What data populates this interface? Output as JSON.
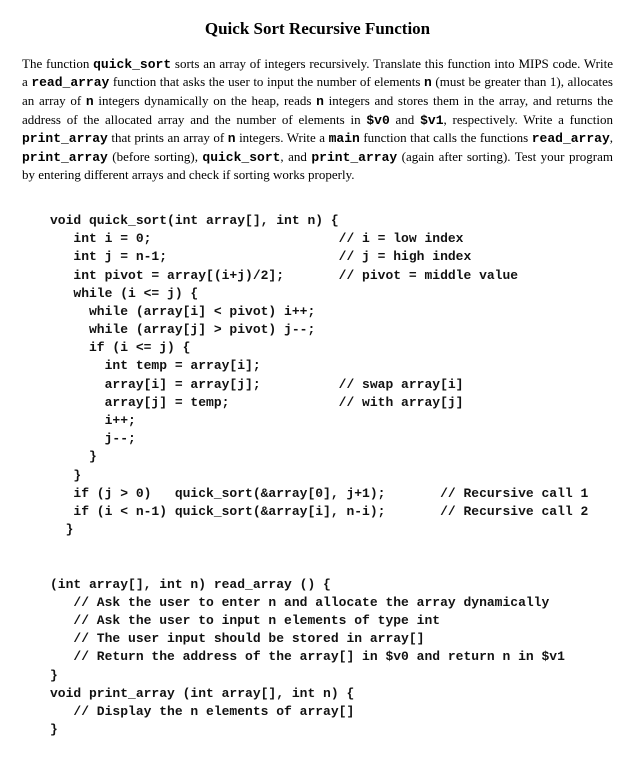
{
  "title": "Quick Sort Recursive Function",
  "intro": {
    "t1": "The function ",
    "b1": "quick_sort",
    "t2": " sorts an array of integers recursively. Translate this function into MIPS code. Write a ",
    "b2": "read_array",
    "t3": " function that asks the user to input the number of elements ",
    "b3": "n",
    "t4": " (must be greater than 1), allocates an array of ",
    "b4": "n",
    "t5": " integers dynamically on the heap, reads ",
    "b5": "n",
    "t6": " integers and stores them in the array, and returns the address of the allocated array and the number of elements in ",
    "b6": "$v0",
    "t7": " and ",
    "b7": "$v1",
    "t8": ", respectively. Write a function ",
    "b8": "print_array",
    "t9": " that prints an array of ",
    "b9": "n",
    "t10": " integers. Write a ",
    "b10": "main",
    "t11": " function that calls the functions ",
    "b11": "read_array",
    "t12": ", ",
    "b12": "print_array",
    "t13": " (before sorting), ",
    "b13": "quick_sort",
    "t14": ", and ",
    "b14": "print_array",
    "t15": " (again after sorting). Test your program by entering different arrays and check if sorting works properly."
  },
  "code": {
    "l1": "void quick_sort(int array[], int n) {",
    "l2": "   int i = 0;                        // i = low index",
    "l3": "   int j = n-1;                      // j = high index",
    "l4": "   int pivot = array[(i+j)/2];       // pivot = middle value",
    "l5": "   while (i <= j) {",
    "l6": "     while (array[i] < pivot) i++;",
    "l7": "     while (array[j] > pivot) j--;",
    "l8": "     if (i <= j) {",
    "l9": "       int temp = array[i];",
    "l10": "       array[i] = array[j];          // swap array[i]",
    "l11": "       array[j] = temp;              // with array[j]",
    "l12": "       i++;",
    "l13": "       j--;",
    "l14": "     }",
    "l15": "   }",
    "l16": "   if (j > 0)   quick_sort(&array[0], j+1);       // Recursive call 1",
    "l17": "   if (i < n-1) quick_sort(&array[i], n-i);       // Recursive call 2",
    "l18": "  }",
    "l19": "",
    "l20": "",
    "l21": "(int array[], int n) read_array () {",
    "l22": "   // Ask the user to enter n and allocate the array dynamically",
    "l23": "   // Ask the user to input n elements of type int",
    "l24": "   // The user input should be stored in array[]",
    "l25": "   // Return the address of the array[] in $v0 and return n in $v1",
    "l26": "}",
    "l27": "void print_array (int array[], int n) {",
    "l28": "   // Display the n elements of array[]",
    "l29": "}"
  }
}
